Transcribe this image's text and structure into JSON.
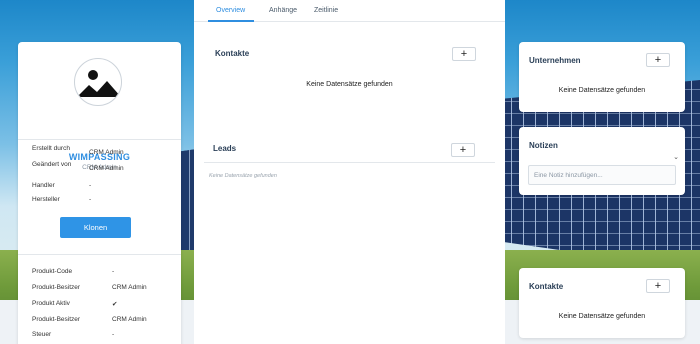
{
  "profile": {
    "name": "WIMPASSING",
    "subtitle": "CRM Admin",
    "fields_top": [
      {
        "key": "Erstellt durch",
        "value": "CRM Admin"
      },
      {
        "key": "Geändert von",
        "value": "CRM Admin"
      },
      {
        "key": "Handler",
        "value": "-"
      },
      {
        "key": "Hersteller",
        "value": "-"
      }
    ],
    "clone_label": "Klonen",
    "fields_bottom": [
      {
        "key": "Produkt-Code",
        "value": "-"
      },
      {
        "key": "Produkt-Besitzer",
        "value": "CRM Admin"
      },
      {
        "key": "Produkt Aktiv",
        "value": "✔"
      },
      {
        "key": "Produkt-Besitzer",
        "value": "CRM Admin"
      },
      {
        "key": "Steuer",
        "value": "-"
      }
    ]
  },
  "tabs": [
    {
      "label": "Overview",
      "active": true
    },
    {
      "label": "Anhänge",
      "active": false
    },
    {
      "label": "Zeitlinie",
      "active": false
    }
  ],
  "center": {
    "kontakte": {
      "title": "Kontakte",
      "add": "+",
      "empty": "Keine Datensätze gefunden"
    },
    "leads": {
      "title": "Leads",
      "add": "+",
      "empty": "Keine Datensätze gefunden"
    }
  },
  "right": {
    "unternehmen": {
      "title": "Unternehmen",
      "add": "+",
      "empty": "Keine Datensätze gefunden"
    },
    "notizen": {
      "title": "Notizen",
      "chevron": "⌄",
      "placeholder": "Eine Notiz hinzufügen..."
    },
    "kontakte": {
      "title": "Kontakte",
      "add": "+",
      "empty": "Keine Datensätze gefunden"
    }
  },
  "colors": {
    "accent": "#2f8ee0",
    "button": "#2f94e6"
  }
}
